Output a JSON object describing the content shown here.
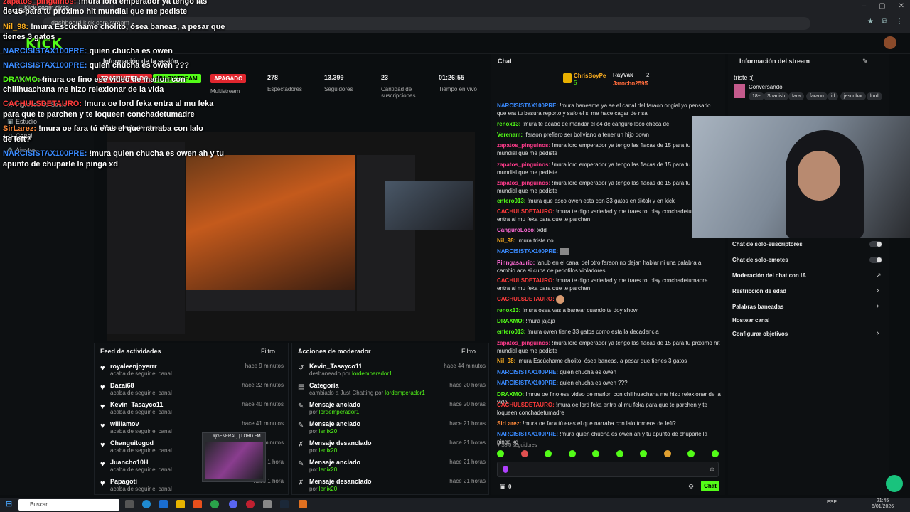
{
  "browser": {
    "tab_title": "Kick seam dkse",
    "url": "dashboard.kick.com/stream"
  },
  "kick": {
    "logo": "KICK"
  },
  "overlay_chat": [
    {
      "user": "zapatos_pinguinos:",
      "text": "!mura lord emperador ya tengo las flacas",
      "color": "#ff3b3b"
    },
    {
      "user": "",
      "text": "de 15 para tu proximo hit mundial que me pediste",
      "color": "#ffffff"
    },
    {
      "user": "Nil_98:",
      "text": "!mura Escúchame cholito, ósea baneas, a pesar que",
      "color": "#ffb020"
    },
    {
      "user": "",
      "text": "tienes 3 gatos",
      "color": "#ffffff"
    },
    {
      "user": "NARCISISTAX100PRE:",
      "text": "quien chucha es owen",
      "color": "#3a8bff"
    },
    {
      "user": "NARCISISTAX100PRE:",
      "text": "quien chucha es owen ???",
      "color": "#3a8bff"
    },
    {
      "user": "DRAXMO:",
      "text": "!mura oe fino ese video de marlon con",
      "color": "#53fc18"
    },
    {
      "user": "",
      "text": "chilihuachana me hizo relexionar de la vida",
      "color": "#ffffff"
    },
    {
      "user": "CACHULSDETAURO:",
      "text": "!mura oe lord feka entra al mu feka",
      "color": "#ff3b3b"
    },
    {
      "user": "",
      "text": "para que te parchen y te loqueen conchadetumadre",
      "color": "#ffffff"
    },
    {
      "user": "SirLarez:",
      "text": "!mura oe fara tú eras el que narraba con lalo torneos",
      "color": "#ff8a3b"
    },
    {
      "user": "",
      "text": "de left?",
      "color": "#ffffff"
    },
    {
      "user": "NARCISISTAX100PRE:",
      "text": "!mura quien chucha es owen ah y tu",
      "color": "#3a8bff"
    },
    {
      "user": "",
      "text": "apunto de chuparle la pinga xd",
      "color": "#ffffff"
    }
  ],
  "sidebar": {
    "items": [
      {
        "icon": "≡",
        "label": "Chatear"
      },
      {
        "icon": "⌂",
        "label": "Monetización"
      },
      {
        "icon": "◎",
        "label": "Ingresos de Socio"
      },
      {
        "icon": "▣",
        "label": "Estudio"
      },
      {
        "icon": "☺",
        "label": "Canal"
      },
      {
        "icon": "⚙",
        "label": "Ajustes"
      }
    ]
  },
  "session": {
    "title": "Información de la sesión",
    "badges": [
      {
        "label": "TRANSMITIENDO",
        "color": "#e0262e"
      },
      {
        "label": "MULTISTREAM",
        "color": "#53fc18"
      },
      {
        "label": "APAGADO",
        "color": "#e0262e"
      }
    ],
    "multistream_label": "Multistream",
    "stats": [
      {
        "value": "278",
        "label": "Espectadores"
      },
      {
        "value": "13.399",
        "label": "Seguidores"
      },
      {
        "value": "23",
        "label": "Cantidad de suscripciones"
      },
      {
        "value": "01:26:55",
        "label": "Tiempo en vivo"
      }
    ],
    "preview_label": "Vista previa del stream"
  },
  "feed": {
    "title": "Feed de actividades",
    "filter": "Filtro",
    "rows": [
      {
        "name": "royaleenjoyerrr",
        "sub": "acaba de seguir el canal",
        "time": "hace 9 minutos"
      },
      {
        "name": "Dazai68",
        "sub": "acaba de seguir el canal",
        "time": "hace 22 minutos"
      },
      {
        "name": "Kevin_Tasayco11",
        "sub": "acaba de seguir el canal",
        "time": "hace 40 minutos"
      },
      {
        "name": "williamov",
        "sub": "acaba de seguir el canal",
        "time": "hace 41 minutos"
      },
      {
        "name": "Changuitogod",
        "sub": "acaba de seguir el canal",
        "time": "hace 41 minutos"
      },
      {
        "name": "Juancho10H",
        "sub": "acaba de seguir el canal",
        "time": "hace 1 hora"
      },
      {
        "name": "Papagoti",
        "sub": "acaba de seguir el canal",
        "time": "hace 1 hora"
      }
    ]
  },
  "mod": {
    "title": "Acciones de moderador",
    "filter": "Filtro",
    "rows": [
      {
        "icon": "↺",
        "title": "Kevin_Tasayco11",
        "pre": "desbaneado por",
        "by": "lordemperador1",
        "time": "hace 44 minutos"
      },
      {
        "icon": "▤",
        "title": "Categoría",
        "pre": "cambiado a Just Chatting por",
        "by": "lordemperador1",
        "time": "hace 20 horas"
      },
      {
        "icon": "✎",
        "title": "Mensaje anclado",
        "pre": "por",
        "by": "lordemperador1",
        "time": "hace 20 horas"
      },
      {
        "icon": "✎",
        "title": "Mensaje anclado",
        "pre": "por",
        "by": "lenix20",
        "time": "hace 21 horas"
      },
      {
        "icon": "✗",
        "title": "Mensaje desanclado",
        "pre": "por",
        "by": "lenix20",
        "time": "hace 21 horas"
      },
      {
        "icon": "✎",
        "title": "Mensaje anclado",
        "pre": "por",
        "by": "lenix20",
        "time": "hace 21 horas"
      },
      {
        "icon": "✗",
        "title": "Mensaje desanclado",
        "pre": "por",
        "by": "lenix20",
        "time": "hace 21 horas"
      }
    ]
  },
  "chat": {
    "title": "Chat",
    "top_gifters": [
      {
        "name": "ChrisBoyPe",
        "count": "5"
      },
      {
        "name": "RayVak",
        "count": "2"
      },
      {
        "name": "Jarocho2595",
        "count": "1"
      }
    ],
    "messages": [
      {
        "user": "NARCISISTAX100PRE:",
        "color": "#3a8bff",
        "text": "!mura baneame ya se el canal del faraon origial yo pensado que era tu basura reporto y safo el si me hace cagar de risa"
      },
      {
        "user": "renox13:",
        "color": "#53fc18",
        "text": "!mura te acabo de mandar el c4 de canguro loco checa dc"
      },
      {
        "user": "Verenam:",
        "color": "#53fc18",
        "text": "!faraon prefiero ser boliviano a tener un hijo down"
      },
      {
        "user": "zapatos_pinguinos:",
        "color": "#ff3b8b",
        "text": "!mura lord emperador ya tengo las flacas de 15 para tu proximo hit mundial que me pediste"
      },
      {
        "user": "zapatos_pinguinos:",
        "color": "#ff3b8b",
        "text": "!mura lord emperador ya tengo las flacas de 15 para tu proximo hit mundial que me pediste"
      },
      {
        "user": "zapatos_pinguinos:",
        "color": "#ff3b8b",
        "text": "!mura lord emperador ya tengo las flacas de 15 para tu proximo hit mundial que me pediste"
      },
      {
        "user": "entero013:",
        "color": "#53fc18",
        "text": "!mura que asco owen esta con 33 gatos en tiktok y en kick"
      },
      {
        "user": "CACHULSDETAURO:",
        "color": "#ff3b3b",
        "text": "!mura te digo variedad y me traes rol play conchadetumadre entra al mu feka para que te parchen"
      },
      {
        "user": "CanguroLoco:",
        "color": "#ff6bd6",
        "text": "xdd"
      },
      {
        "user": "Nil_98:",
        "color": "#ffb020",
        "text": "!mura triste no"
      },
      {
        "user": "NARCISISTAX100PRE:",
        "color": "#3a8bff",
        "text": ""
      },
      {
        "user": "Pinngasaurio:",
        "color": "#ff6bd6",
        "text": "!anub en el canal del otro faraon no dejan hablar ni una palabra a cambio aca si cuna de pedofilos violadores"
      },
      {
        "user": "CACHULSDETAURO:",
        "color": "#ff3b3b",
        "text": "!mura te digo variedad y me traes rol play conchadetumadre entra al mu feka para que te parchen"
      },
      {
        "user": "CACHULSDETAURO:",
        "color": "#ff3b3b",
        "text": ""
      },
      {
        "user": "renox13:",
        "color": "#53fc18",
        "text": "!mura osea vas a banear cuando te doy show"
      },
      {
        "user": "DRAXMO:",
        "color": "#53fc18",
        "text": "!mura jajaja"
      },
      {
        "user": "entero013:",
        "color": "#53fc18",
        "text": "!mura owen tiene 33 gatos como esta la decadencia"
      },
      {
        "user": "zapatos_pinguinos:",
        "color": "#ff3b8b",
        "text": "!mura lord emperador ya tengo las flacas de 15 para tu proximo hit mundial que me pediste"
      },
      {
        "user": "Nil_98:",
        "color": "#ffb020",
        "text": "!mura Escúchame cholito, ósea baneas, a pesar que tienes 3 gatos"
      },
      {
        "user": "NARCISISTAX100PRE:",
        "color": "#3a8bff",
        "text": "quien chucha es owen"
      },
      {
        "user": "NARCISISTAX100PRE:",
        "color": "#3a8bff",
        "text": "quien chucha es owen ???"
      },
      {
        "user": "DRAXMO:",
        "color": "#53fc18",
        "text": "!mrue oe fino ese video de marlon con chilihuachana me hizo relexionar de la vida"
      },
      {
        "user": "CACHULSDETAURO:",
        "color": "#ff3b3b",
        "text": "!mura oe lord feka entra al mu feka para que te parchen y te loqueen conchadetumadre"
      },
      {
        "user": "SirLarez:",
        "color": "#ff8a3b",
        "text": "!mura oe fara tú eras el que narraba con lalo torneos de left?"
      },
      {
        "user": "NARCISISTAX100PRE:",
        "color": "#3a8bff",
        "text": "!mura quien chucha es owen ah y tu apunto de chuparle la pinga xd"
      }
    ],
    "followers_only": "Solo seguidores",
    "count": "0",
    "send_label": "Chat"
  },
  "info": {
    "title": "Información del stream",
    "stream_title": "triste :(",
    "category": "Conversando",
    "tags": [
      "18+",
      "Spanish",
      "fara",
      "faraon",
      "irl",
      "jescobar",
      "lord"
    ],
    "settings": [
      {
        "label": "Chat de solo-suscriptores",
        "control": "toggle"
      },
      {
        "label": "Chat de solo-emotes",
        "control": "toggle"
      },
      {
        "label": "Moderación del chat con IA",
        "control": "link"
      },
      {
        "label": "Restricción de edad",
        "control": "chevron"
      },
      {
        "label": "Palabras baneadas",
        "control": "chevron"
      },
      {
        "label": "Hostear canal",
        "control": "none"
      },
      {
        "label": "Configurar objetivos",
        "control": "chevron"
      }
    ]
  },
  "taskbar": {
    "search": "Buscar",
    "lang": "ESP",
    "time": "21:45",
    "date": "6/01/2026"
  },
  "thumb": {
    "label": "#[GENERAL] | LORD EM..."
  }
}
